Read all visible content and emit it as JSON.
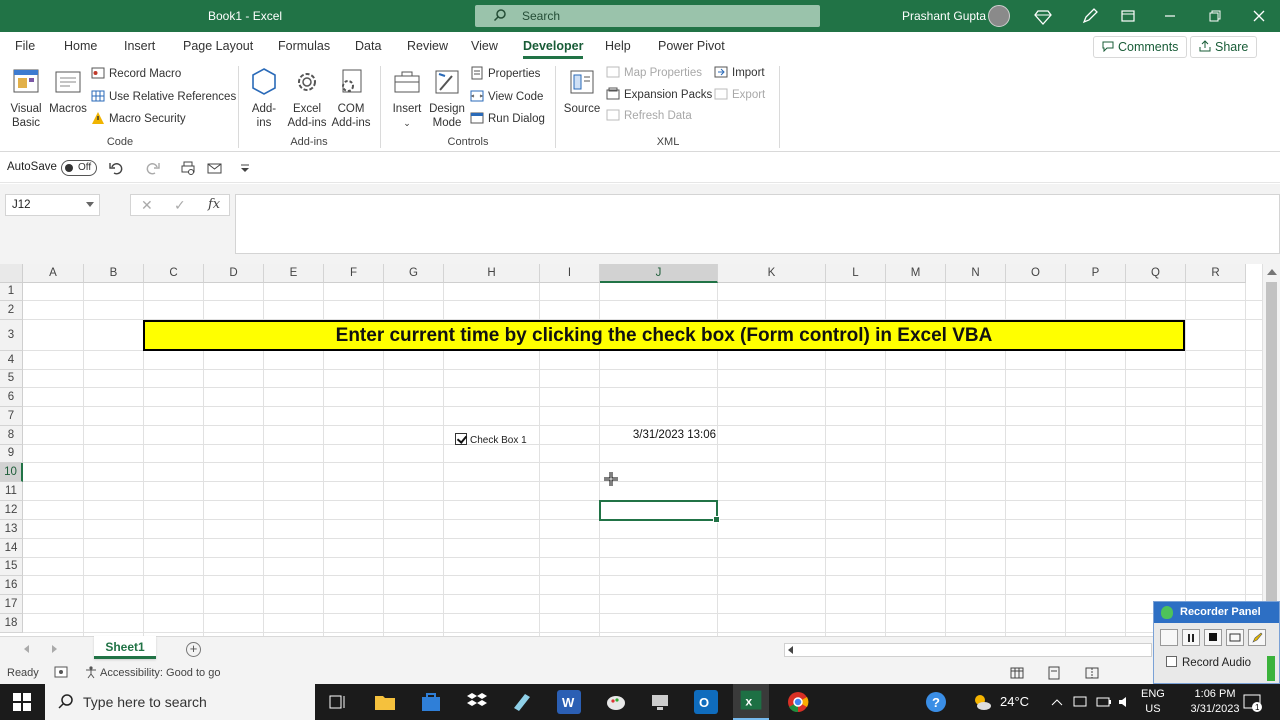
{
  "window": {
    "title": "Book1 - Excel",
    "search_placeholder": "Search",
    "user_name": "Prashant Gupta"
  },
  "ribbon_tabs": [
    "File",
    "Home",
    "Insert",
    "Page Layout",
    "Formulas",
    "Data",
    "Review",
    "View",
    "Developer",
    "Help",
    "Power Pivot"
  ],
  "active_tab": "Developer",
  "ribbon_actions": {
    "comments": "Comments",
    "share": "Share"
  },
  "groups": {
    "code": {
      "label": "Code",
      "visual_basic": [
        "Visual",
        "Basic"
      ],
      "macros": "Macros",
      "record_macro": "Record Macro",
      "use_relative": "Use Relative References",
      "macro_security": "Macro Security"
    },
    "addins": {
      "label": "Add-ins",
      "addins": [
        "Add-",
        "ins"
      ],
      "excel_addins": [
        "Excel",
        "Add-ins"
      ],
      "com_addins": [
        "COM",
        "Add-ins"
      ]
    },
    "controls": {
      "label": "Controls",
      "insert": "Insert",
      "design_mode": [
        "Design",
        "Mode"
      ],
      "properties": "Properties",
      "view_code": "View Code",
      "run_dialog": "Run Dialog"
    },
    "xml": {
      "label": "XML",
      "source": "Source",
      "map_properties": "Map Properties",
      "expansion_packs": "Expansion Packs",
      "refresh_data": "Refresh Data",
      "import": "Import",
      "export": "Export"
    }
  },
  "quick_access": {
    "autosave_label": "AutoSave",
    "autosave_state": "Off"
  },
  "formula_bar": {
    "name_box": "J12",
    "cancel": "✕",
    "enter": "✓",
    "fx": "fx",
    "value": ""
  },
  "columns": [
    "A",
    "B",
    "C",
    "D",
    "E",
    "F",
    "G",
    "H",
    "I",
    "J",
    "K",
    "L",
    "M",
    "N",
    "O",
    "P",
    "Q",
    "R"
  ],
  "rows": [
    "1",
    "2",
    "3",
    "4",
    "5",
    "6",
    "7",
    "8",
    "9",
    "10",
    "11",
    "12",
    "13",
    "14",
    "15",
    "16",
    "17",
    "18"
  ],
  "selected_column": "J",
  "selected_row": "10",
  "sheet": {
    "banner": "Enter current time by clicking the check box (Form control) in Excel VBA",
    "checkbox_label": "Check Box 1",
    "checkbox_checked": true,
    "j8_value": "3/31/2023 13:06"
  },
  "sheet_tabs": [
    "Sheet1"
  ],
  "status": {
    "ready": "Ready",
    "accessibility": "Accessibility: Good to go"
  },
  "recorder": {
    "title": "Recorder Panel",
    "record_audio": "Record Audio"
  },
  "taskbar": {
    "search_placeholder": "Type here to search",
    "weather": "24°C",
    "lang_1": "ENG",
    "lang_2": "US",
    "time": "1:06 PM",
    "date": "3/31/2023",
    "notification_count": "1"
  },
  "colors": {
    "excel_green": "#217346",
    "banner_fill": "#ffff00",
    "taskbar": "#1b1b1b"
  }
}
